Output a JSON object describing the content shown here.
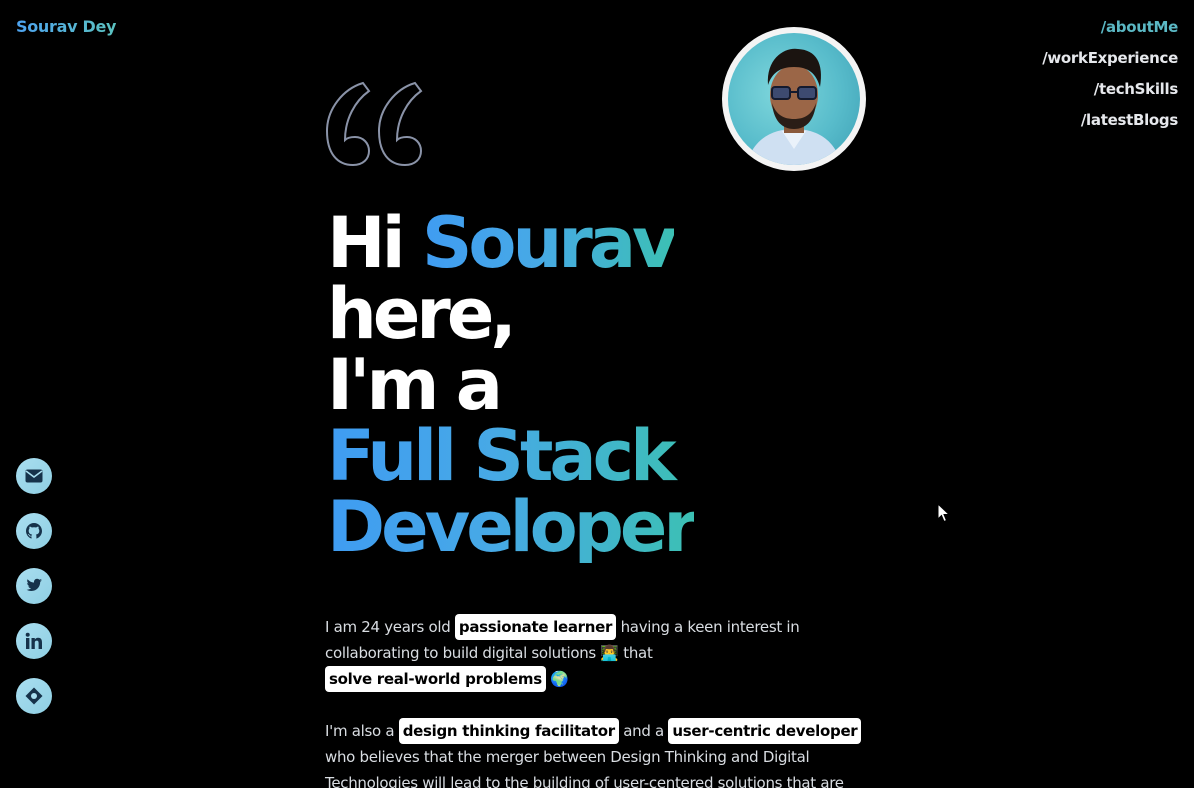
{
  "brand": "Sourav Dey",
  "nav": [
    {
      "label": "/aboutMe",
      "active": true
    },
    {
      "label": "/workExperience",
      "active": false
    },
    {
      "label": "/techSkills",
      "active": false
    },
    {
      "label": "/latestBlogs",
      "active": false
    }
  ],
  "hero": {
    "greeting": "Hi ",
    "name": "Sourav",
    "line2": "here,",
    "line3": "I'm a",
    "role_line1": "Full Stack",
    "role_line2": "Developer"
  },
  "intro": {
    "p1_a": "I am 24 years old ",
    "p1_chip1": "passionate learner",
    "p1_b": " having a keen interest in collaborating to build digital solutions ",
    "p1_emoji1": "👨‍💻",
    "p1_c": " that",
    "p1_chip2": "solve real-world problems",
    "p1_emoji2": "🌍",
    "p2_a": "I'm also a ",
    "p2_chip1": "design thinking facilitator",
    "p2_b": " and a ",
    "p2_chip2": "user-centric developer",
    "p2_c": "who believes that the merger between Design Thinking and Digital Technologies will lead to the building of user-centered solutions that are"
  },
  "social": [
    {
      "icon": "mail-icon"
    },
    {
      "icon": "github-icon"
    },
    {
      "icon": "twitter-icon"
    },
    {
      "icon": "linkedin-icon"
    },
    {
      "icon": "location-icon"
    }
  ],
  "colors": {
    "accent_start": "#3f9cf2",
    "accent_end": "#3cc0b4",
    "background": "#000000",
    "chip_bg": "#ffffff"
  }
}
